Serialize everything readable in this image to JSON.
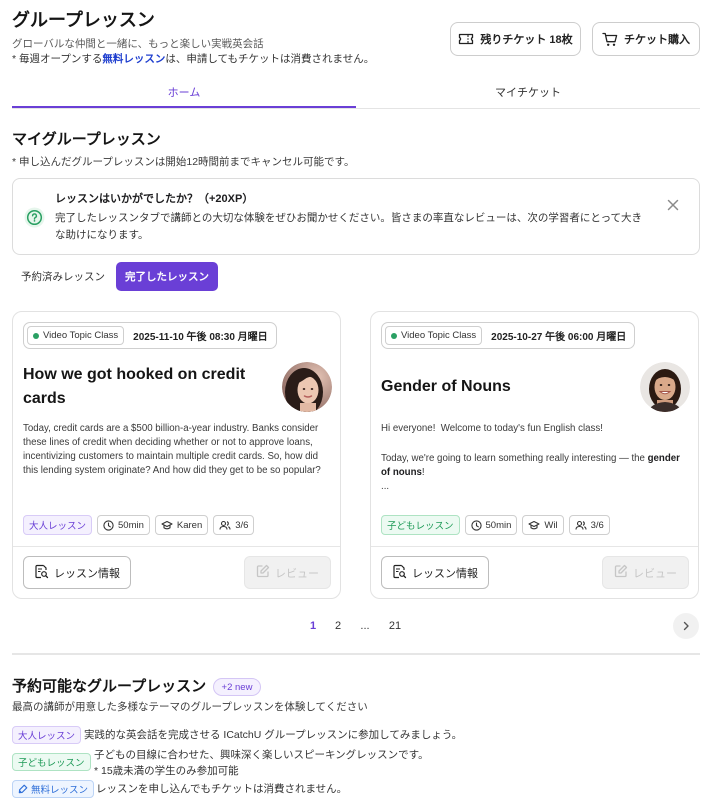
{
  "colors": {
    "accent": "#6a3fd6",
    "link_blue": "#1f3fcf",
    "adult": "#6a3fd6",
    "adult_bg": "#f4f0fe",
    "kids": "#1e9a57",
    "kids_bg": "#ecfaf2",
    "free": "#2f6fd8",
    "free_bg": "#eef5ff",
    "success": "#2aa063"
  },
  "header": {
    "title": "グループレッスン",
    "subtitle": "グローバルな仲間と一緒に、もっと楽しい実戦英会話",
    "note": {
      "prefix": "* 毎週オープンする",
      "highlight": "無料レッスン",
      "suffix": "は、申請してもチケットは消費されません。"
    },
    "ticket_balance": {
      "label": "残りチケット 18枚",
      "icon": "ticket-icon"
    },
    "buy_ticket": {
      "label": "チケット購入",
      "icon": "cart-icon"
    }
  },
  "tabs": [
    {
      "label": "ホーム",
      "active": true
    },
    {
      "label": "マイチケット",
      "active": false
    }
  ],
  "my_lessons": {
    "heading": "マイグループレッスン",
    "note": "* 申し込んだグループレッスンは開始12時間前までキャンセル可能です。",
    "review_prompt": {
      "title": "レッスンはいかがでしたか？（+20XP）",
      "text": "完了したレッスンタブで講師との大切な体験をぜひお聞かせください。皆さまの率直なレビューは、次の学習者にとって大きな助けになります。",
      "icon": "question-circle-icon",
      "close_icon": "close-icon"
    },
    "filters": [
      {
        "label": "予約済みレッスン",
        "active": false
      },
      {
        "label": "完了したレッスン",
        "active": true
      }
    ],
    "cards": [
      {
        "category": "Video Topic Class",
        "datetime": "2025-11-10 午後 08:30 月曜日",
        "title": "How we got hooked on credit cards",
        "description": [
          {
            "text": "Today, credit cards are a $500 billion-a-year industry. Banks consider these lines of credit when deciding whether or not to approve loans, incentivizing customers to maintain multiple credit cards. So, how did this lending system originate? And how did they get to be so popular?"
          }
        ],
        "level": "大人レッスン",
        "level_type": "adult",
        "duration": "50min",
        "teacher": "Karen",
        "capacity": "3/6",
        "info_button": "レッスン情報",
        "review_button": "レビュー",
        "review_enabled": false
      },
      {
        "category": "Video Topic Class",
        "datetime": "2025-10-27 午後 06:00 月曜日",
        "title": "Gender of Nouns",
        "description": [
          {
            "text": "Hi everyone!  Welcome to today's fun English class!"
          },
          {
            "text": "Today, we're going to learn something really interesting — the ",
            "bold": "gender of nouns",
            "after": "!"
          },
          {
            "text": "..."
          }
        ],
        "level": "子どもレッスン",
        "level_type": "kids",
        "duration": "50min",
        "teacher": "Wil",
        "capacity": "3/6",
        "info_button": "レッスン情報",
        "review_button": "レビュー",
        "review_enabled": false
      }
    ]
  },
  "pagination": {
    "pages": [
      "1",
      "2",
      "...",
      "21"
    ],
    "current": "1",
    "next_icon": "chevron-right-icon"
  },
  "available": {
    "heading": "予約可能なグループレッスン",
    "new_badge": "+2 new",
    "description": "最高の講師が用意した多様なテーマのグループレッスンを体験してください",
    "types": [
      {
        "badge": "大人レッスン",
        "kind": "adult",
        "lines": [
          "実践的な英会話を完成させる ICatchU グループレッスンに参加してみましょう。"
        ]
      },
      {
        "badge": "子どもレッスン",
        "kind": "kids",
        "lines": [
          "子どもの目線に合わせた、興味深く楽しいスピーキングレッスンです。",
          "* 15歳未満の学生のみ参加可能"
        ]
      },
      {
        "badge": "無料レッスン",
        "kind": "free",
        "icon": "microphone-icon",
        "lines": [
          "レッスンを申し込んでもチケットは消費されません。"
        ]
      }
    ]
  }
}
